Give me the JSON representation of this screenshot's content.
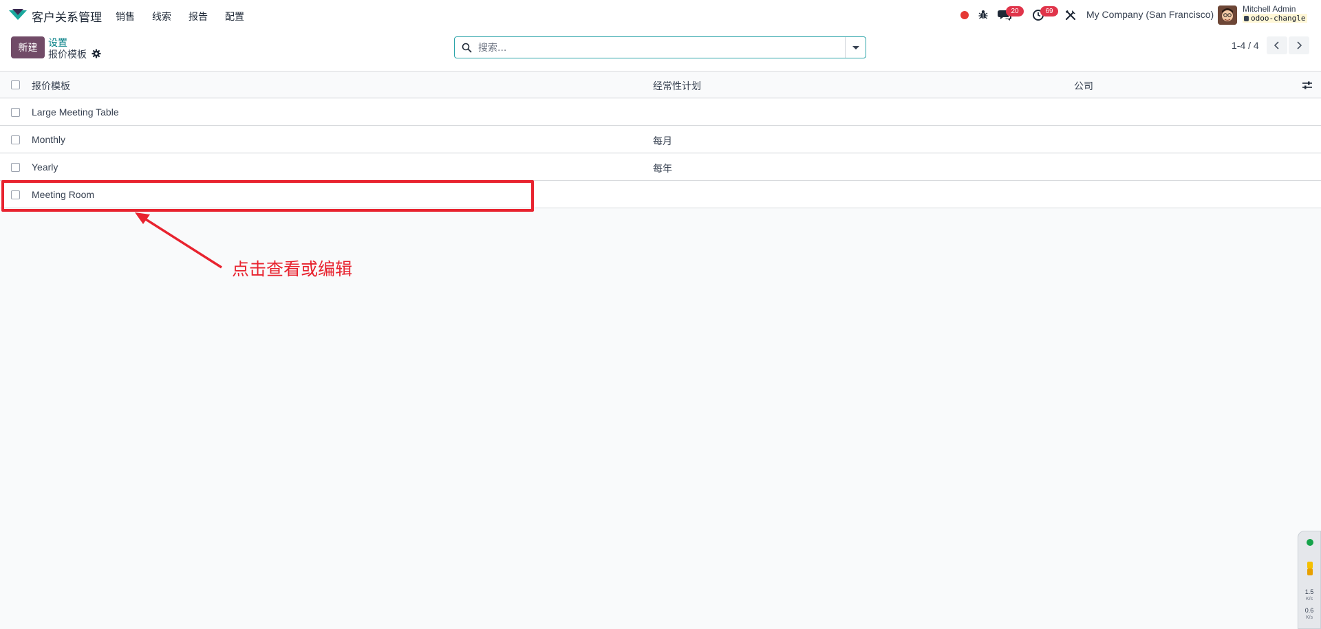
{
  "navbar": {
    "app_name": "客户关系管理",
    "menu": [
      "销售",
      "线索",
      "报告",
      "配置"
    ],
    "messages_count": "20",
    "activities_count": "69",
    "company": "My Company (San Francisco)",
    "user_name": "Mitchell Admin",
    "db_name": "odoo-changle"
  },
  "control": {
    "new_label": "新建",
    "breadcrumb_parent": "设置",
    "breadcrumb_current": "报价模板",
    "search_placeholder": "搜索...",
    "pager": "1-4 / 4"
  },
  "table": {
    "columns": [
      "报价模板",
      "经常性计划",
      "公司"
    ],
    "rows": [
      {
        "name": "Large Meeting Table",
        "plan": "",
        "company": ""
      },
      {
        "name": "Monthly",
        "plan": "每月",
        "company": ""
      },
      {
        "name": "Yearly",
        "plan": "每年",
        "company": ""
      },
      {
        "name": "Meeting Room",
        "plan": "",
        "company": ""
      }
    ]
  },
  "annotation": {
    "text": "点击查看或编辑",
    "color": "#e8232f"
  },
  "net_widget": {
    "up_value": "1.5",
    "up_unit": "K/s",
    "down_value": "0.6",
    "down_unit": "K/s"
  },
  "colors": {
    "primary": "#714b67",
    "link": "#017e84",
    "badge": "#e0344a",
    "recording": "#e53935"
  }
}
